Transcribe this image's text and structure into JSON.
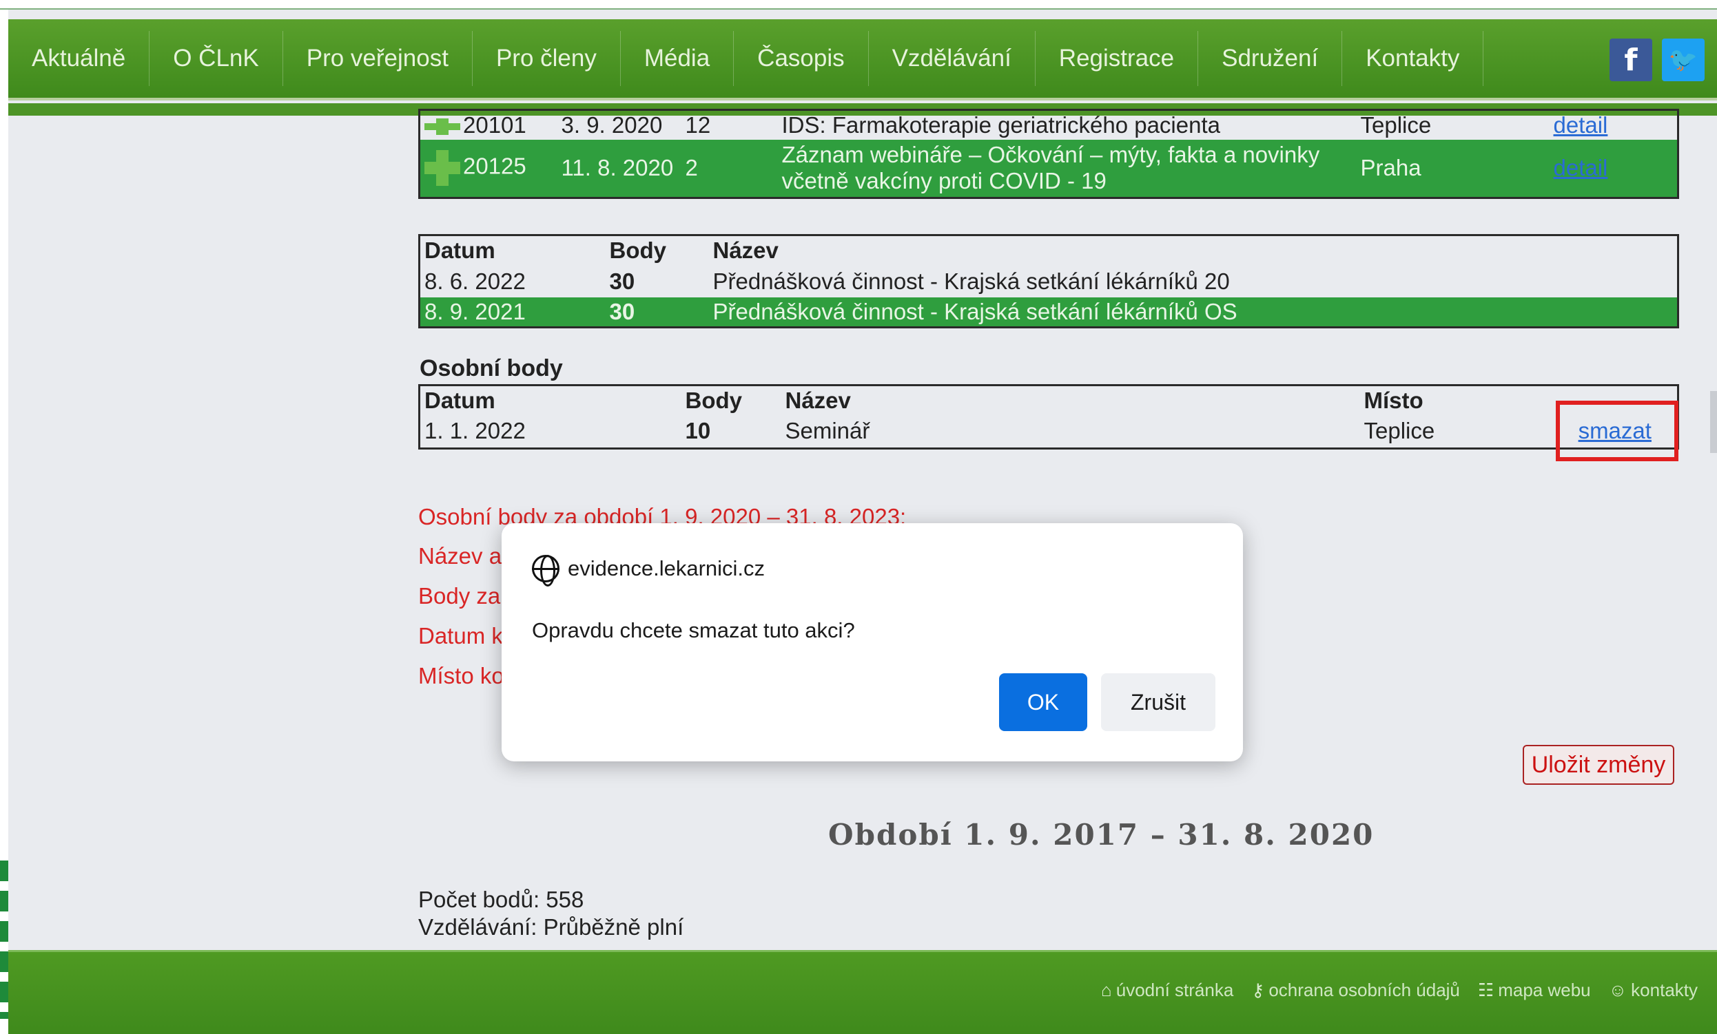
{
  "nav": {
    "items": [
      "Aktuálně",
      "O ČLnK",
      "Pro veřejnost",
      "Pro členy",
      "Média",
      "Časopis",
      "Vzdělávání",
      "Registrace",
      "Sdružení",
      "Kontakty"
    ],
    "facebook": "f",
    "twitter": "🐦"
  },
  "events_table": {
    "rows": [
      {
        "id": "20101",
        "date": "3. 9. 2020",
        "points": "12",
        "title": "IDS: Farmakoterapie geriatrického pacienta",
        "place": "Teplice",
        "link": "detail"
      },
      {
        "id": "20125",
        "date": "11. 8. 2020",
        "points": "2",
        "title": "Záznam webináře – Očkování – mýty, fakta a novinky včetně vakcíny proti COVID - 19",
        "place": "Praha",
        "link": "detail"
      }
    ]
  },
  "lectures_table": {
    "headers": {
      "date": "Datum",
      "points": "Body",
      "title": "Název"
    },
    "rows": [
      {
        "date": "8. 6. 2022",
        "points": "30",
        "title": "Přednášková činnost - Krajská setkání lékárníků 20"
      },
      {
        "date": "8. 9. 2021",
        "points": "30",
        "title": "Přednášková činnost - Krajská setkání lékárníků OS"
      }
    ]
  },
  "personal": {
    "label": "Osobní body",
    "headers": {
      "date": "Datum",
      "points": "Body",
      "title": "Název",
      "place": "Místo"
    },
    "row": {
      "date": "1. 1. 2022",
      "points": "10",
      "title": "Seminář",
      "place": "Teplice",
      "action": "smazat"
    }
  },
  "form_labels": {
    "period": "Osobní body za období 1. 9. 2020 – 31. 8. 2023:",
    "name": "Název al",
    "points": "Body za",
    "date": "Datum k",
    "place": "Místo ko"
  },
  "save_button": "Uložit změny",
  "period_title": "Období 1. 9. 2017 – 31. 8. 2020",
  "summary": {
    "points": "Počet bodů: 558",
    "education": "Vzdělávání: Průběžně plní"
  },
  "footer": {
    "home": "úvodní stránka",
    "privacy": "ochrana osobních údajů",
    "sitemap": "mapa webu",
    "contacts": "kontakty"
  },
  "dialog": {
    "origin": "evidence.lekarnici.cz",
    "message": "Opravdu chcete smazat tuto akci?",
    "ok": "OK",
    "cancel": "Zrušit"
  }
}
